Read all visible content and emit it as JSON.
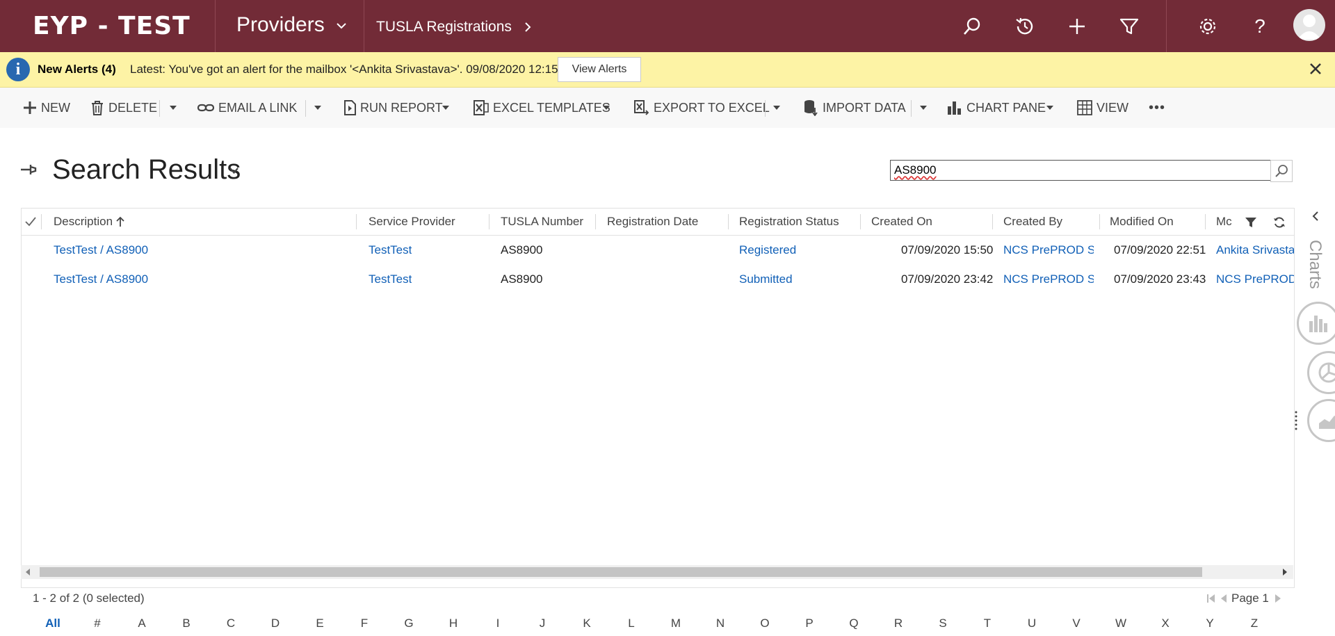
{
  "app": {
    "brand": "EYP - TEST",
    "area": "Providers",
    "entity": "TUSLA Registrations"
  },
  "toolbar_icons": [
    "search-icon",
    "history-icon",
    "plus-icon",
    "filter-icon",
    "settings-icon",
    "help-icon",
    "avatar"
  ],
  "alert": {
    "title": "New Alerts (4)",
    "message": "Latest: You've got an alert for the mailbox '<Ankita Srivastava>'. 09/08/2020 12:15",
    "button": "View Alerts"
  },
  "commands": {
    "new": "NEW",
    "delete": "DELETE",
    "email_link": "EMAIL A LINK",
    "run_report": "RUN REPORT",
    "excel_templates": "EXCEL TEMPLATES",
    "export_excel": "EXPORT TO EXCEL",
    "import_data": "IMPORT DATA",
    "chart_pane": "CHART PANE",
    "view": "VIEW",
    "more": "•••"
  },
  "page": {
    "title": "Search Results"
  },
  "search": {
    "value": "AS8900"
  },
  "grid": {
    "columns": [
      "Description",
      "Service Provider",
      "TUSLA Number",
      "Registration Date",
      "Registration Status",
      "Created On",
      "Created By",
      "Modified On",
      "Mc"
    ],
    "rows": [
      {
        "description": "TestTest / AS8900",
        "service_provider": "TestTest",
        "tusla_number": "AS8900",
        "registration_date": "",
        "registration_status": "Registered",
        "created_on": "07/09/2020 15:50",
        "created_by": "NCS PrePROD S...",
        "modified_on": "07/09/2020 22:51",
        "modified_by": "Ankita Srivastav"
      },
      {
        "description": "TestTest / AS8900",
        "service_provider": "TestTest",
        "tusla_number": "AS8900",
        "registration_date": "",
        "registration_status": "Submitted",
        "created_on": "07/09/2020 23:42",
        "created_by": "NCS PrePROD S...",
        "modified_on": "07/09/2020 23:43",
        "modified_by": "NCS PrePROD S"
      }
    ],
    "record_count": "1 - 2 of 2 (0 selected)",
    "page_label": "Page 1"
  },
  "alphabet": [
    "All",
    "#",
    "A",
    "B",
    "C",
    "D",
    "E",
    "F",
    "G",
    "H",
    "I",
    "J",
    "K",
    "L",
    "M",
    "N",
    "O",
    "P",
    "Q",
    "R",
    "S",
    "T",
    "U",
    "V",
    "W",
    "X",
    "Y",
    "Z"
  ],
  "charts_panel": {
    "label": "Charts"
  },
  "colors": {
    "nav_bg": "#722b37",
    "alert_bg": "#fdf3a5",
    "link": "#1160b7",
    "info_icon": "#2868b0"
  }
}
